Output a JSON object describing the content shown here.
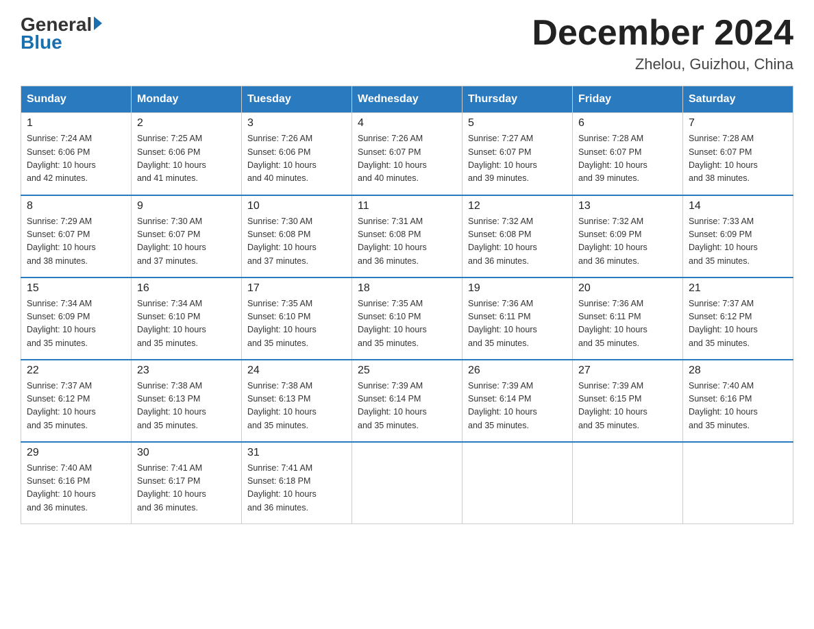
{
  "header": {
    "logo_general": "General",
    "logo_blue": "Blue",
    "month_title": "December 2024",
    "location": "Zhelou, Guizhou, China"
  },
  "days_of_week": [
    "Sunday",
    "Monday",
    "Tuesday",
    "Wednesday",
    "Thursday",
    "Friday",
    "Saturday"
  ],
  "weeks": [
    [
      {
        "day": "1",
        "sunrise": "7:24 AM",
        "sunset": "6:06 PM",
        "daylight": "10 hours and 42 minutes."
      },
      {
        "day": "2",
        "sunrise": "7:25 AM",
        "sunset": "6:06 PM",
        "daylight": "10 hours and 41 minutes."
      },
      {
        "day": "3",
        "sunrise": "7:26 AM",
        "sunset": "6:06 PM",
        "daylight": "10 hours and 40 minutes."
      },
      {
        "day": "4",
        "sunrise": "7:26 AM",
        "sunset": "6:07 PM",
        "daylight": "10 hours and 40 minutes."
      },
      {
        "day": "5",
        "sunrise": "7:27 AM",
        "sunset": "6:07 PM",
        "daylight": "10 hours and 39 minutes."
      },
      {
        "day": "6",
        "sunrise": "7:28 AM",
        "sunset": "6:07 PM",
        "daylight": "10 hours and 39 minutes."
      },
      {
        "day": "7",
        "sunrise": "7:28 AM",
        "sunset": "6:07 PM",
        "daylight": "10 hours and 38 minutes."
      }
    ],
    [
      {
        "day": "8",
        "sunrise": "7:29 AM",
        "sunset": "6:07 PM",
        "daylight": "10 hours and 38 minutes."
      },
      {
        "day": "9",
        "sunrise": "7:30 AM",
        "sunset": "6:07 PM",
        "daylight": "10 hours and 37 minutes."
      },
      {
        "day": "10",
        "sunrise": "7:30 AM",
        "sunset": "6:08 PM",
        "daylight": "10 hours and 37 minutes."
      },
      {
        "day": "11",
        "sunrise": "7:31 AM",
        "sunset": "6:08 PM",
        "daylight": "10 hours and 36 minutes."
      },
      {
        "day": "12",
        "sunrise": "7:32 AM",
        "sunset": "6:08 PM",
        "daylight": "10 hours and 36 minutes."
      },
      {
        "day": "13",
        "sunrise": "7:32 AM",
        "sunset": "6:09 PM",
        "daylight": "10 hours and 36 minutes."
      },
      {
        "day": "14",
        "sunrise": "7:33 AM",
        "sunset": "6:09 PM",
        "daylight": "10 hours and 35 minutes."
      }
    ],
    [
      {
        "day": "15",
        "sunrise": "7:34 AM",
        "sunset": "6:09 PM",
        "daylight": "10 hours and 35 minutes."
      },
      {
        "day": "16",
        "sunrise": "7:34 AM",
        "sunset": "6:10 PM",
        "daylight": "10 hours and 35 minutes."
      },
      {
        "day": "17",
        "sunrise": "7:35 AM",
        "sunset": "6:10 PM",
        "daylight": "10 hours and 35 minutes."
      },
      {
        "day": "18",
        "sunrise": "7:35 AM",
        "sunset": "6:10 PM",
        "daylight": "10 hours and 35 minutes."
      },
      {
        "day": "19",
        "sunrise": "7:36 AM",
        "sunset": "6:11 PM",
        "daylight": "10 hours and 35 minutes."
      },
      {
        "day": "20",
        "sunrise": "7:36 AM",
        "sunset": "6:11 PM",
        "daylight": "10 hours and 35 minutes."
      },
      {
        "day": "21",
        "sunrise": "7:37 AM",
        "sunset": "6:12 PM",
        "daylight": "10 hours and 35 minutes."
      }
    ],
    [
      {
        "day": "22",
        "sunrise": "7:37 AM",
        "sunset": "6:12 PM",
        "daylight": "10 hours and 35 minutes."
      },
      {
        "day": "23",
        "sunrise": "7:38 AM",
        "sunset": "6:13 PM",
        "daylight": "10 hours and 35 minutes."
      },
      {
        "day": "24",
        "sunrise": "7:38 AM",
        "sunset": "6:13 PM",
        "daylight": "10 hours and 35 minutes."
      },
      {
        "day": "25",
        "sunrise": "7:39 AM",
        "sunset": "6:14 PM",
        "daylight": "10 hours and 35 minutes."
      },
      {
        "day": "26",
        "sunrise": "7:39 AM",
        "sunset": "6:14 PM",
        "daylight": "10 hours and 35 minutes."
      },
      {
        "day": "27",
        "sunrise": "7:39 AM",
        "sunset": "6:15 PM",
        "daylight": "10 hours and 35 minutes."
      },
      {
        "day": "28",
        "sunrise": "7:40 AM",
        "sunset": "6:16 PM",
        "daylight": "10 hours and 35 minutes."
      }
    ],
    [
      {
        "day": "29",
        "sunrise": "7:40 AM",
        "sunset": "6:16 PM",
        "daylight": "10 hours and 36 minutes."
      },
      {
        "day": "30",
        "sunrise": "7:41 AM",
        "sunset": "6:17 PM",
        "daylight": "10 hours and 36 minutes."
      },
      {
        "day": "31",
        "sunrise": "7:41 AM",
        "sunset": "6:18 PM",
        "daylight": "10 hours and 36 minutes."
      },
      null,
      null,
      null,
      null
    ]
  ],
  "labels": {
    "sunrise": "Sunrise:",
    "sunset": "Sunset:",
    "daylight": "Daylight:"
  }
}
